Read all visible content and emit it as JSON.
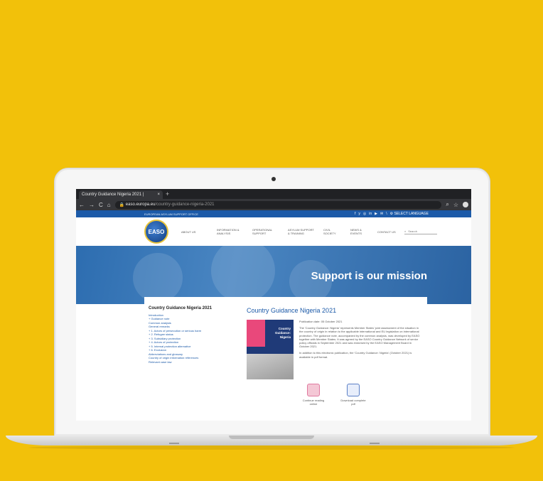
{
  "browser": {
    "tab_title": "Country Guidance Nigeria 2021 |",
    "tab_close": "×",
    "new_tab": "+",
    "url_domain": "easo.europa.eu",
    "url_path": "/country-guidance-nigeria-2021"
  },
  "site": {
    "top_label": "EUROPEAN ASYLUM SUPPORT OFFICE",
    "social": [
      "f",
      "y",
      "◎",
      "in",
      "▶",
      "✉",
      "\\"
    ],
    "language": "⚙ SELECT LANGUAGE",
    "logo_text": "EASO",
    "nav": [
      {
        "label": "ABOUT US"
      },
      {
        "label": "INFORMATION & ANALYSIS"
      },
      {
        "label": "OPERATIONAL SUPPORT"
      },
      {
        "label": "ASYLUM SUPPORT & TRAINING"
      },
      {
        "label": "CIVIL SOCIETY"
      },
      {
        "label": "NEWS & EVENTS"
      },
      {
        "label": "CONTACT US"
      }
    ],
    "search_placeholder": "Search",
    "hero_title": "Support is our mission"
  },
  "toc": {
    "title": "Country Guidance Nigeria 2021",
    "items": [
      "Introduction",
      "+ Guidance note",
      "Common analysis",
      "General remarks",
      "+ 1. Actors of persecution or serious harm",
      "+ 2. Refugee status",
      "+ 3. Subsidiary protection",
      "+ 4. Actors of protection",
      "+ 5. Internal protection alternative",
      "+ 6. Exclusion",
      "Abbreviations and glossary",
      "Country of origin information references",
      "Relevant case law"
    ]
  },
  "article": {
    "title": "Country Guidance Nigeria 2021",
    "cover_text_1": "Country",
    "cover_text_2": "Guidance:",
    "cover_text_3": "Nigeria",
    "pub_date": "Publication date: 05 October 2021",
    "para1": "The 'Country Guidance: Nigeria' represents Member States' joint assessment of the situation in the country of origin in relation to the applicable international and EU legislation on international protection. The guidance note, accompanied by the common analysis, was developed by EASO together with Member States. It was agreed by the EASO Country Guidance Network of senior policy officials in September 2021 and was endorsed by the EASO Management Board in October 2021.",
    "para2": "In addition to this electronic publication, the 'Country Guidance: Nigeria' (October 2021) is available in pdf format.",
    "continue_label": "Continue reading online",
    "download_label": "Download complete pdf"
  }
}
